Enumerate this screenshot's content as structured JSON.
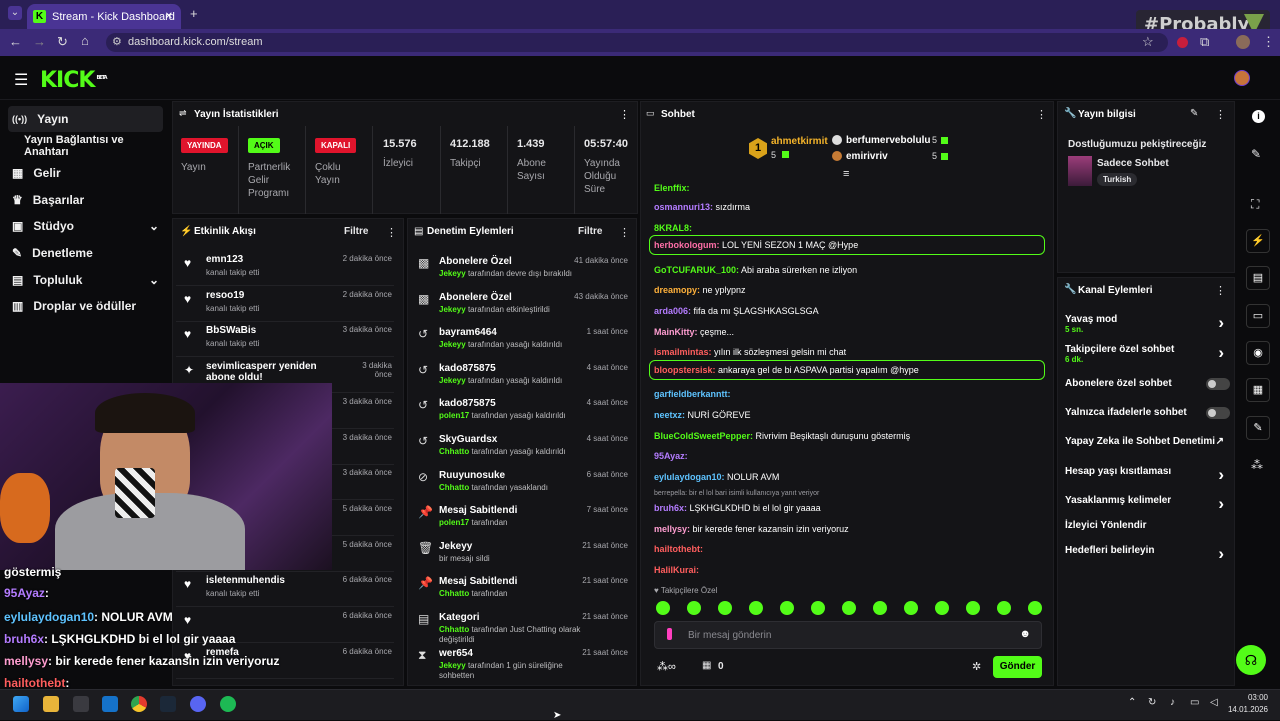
{
  "browser": {
    "tab_title": "Stream - Kick Dashboard",
    "url": "dashboard.kick.com/stream",
    "new_tab": "+",
    "close": "✕",
    "watermark": "#Probably"
  },
  "app": {
    "logo": "KICK",
    "logo_beta": "BETA"
  },
  "sidebar": {
    "items": [
      {
        "label": "Yayın",
        "icon": "((•))"
      },
      {
        "label": "Yayın Bağlantısı ve Anahtarı",
        "icon": ""
      },
      {
        "label": "Gelir",
        "icon": "▦"
      },
      {
        "label": "Başarılar",
        "icon": "🏆"
      },
      {
        "label": "Stüdyo",
        "icon": "▣"
      },
      {
        "label": "Denetleme",
        "icon": "🔧"
      },
      {
        "label": "Topluluk",
        "icon": "▤"
      },
      {
        "label": "Droplar ve ödüller",
        "icon": "▥"
      }
    ]
  },
  "stats": {
    "title": "Yayın İstatistikleri",
    "items": [
      {
        "badge": "YAYINDA",
        "label": "Yayın"
      },
      {
        "badge": "AÇIK",
        "label": "Partnerlik Gelir Programı"
      },
      {
        "badge": "KAPALI",
        "label": "Çoklu Yayın"
      },
      {
        "value": "15.576",
        "label": "İzleyici"
      },
      {
        "value": "412.188",
        "label": "Takipçi"
      },
      {
        "value": "1.439",
        "label": "Abone Sayısı"
      },
      {
        "value": "05:57:40",
        "label": "Yayında Olduğu Süre"
      }
    ]
  },
  "activity": {
    "title": "Etkinlik Akışı",
    "filter": "Filtre",
    "rows": [
      {
        "name": "emn123",
        "sub": "kanalı takip etti",
        "time": "2 dakika önce"
      },
      {
        "name": "resoo19",
        "sub": "kanalı takip etti",
        "time": "2 dakika önce"
      },
      {
        "name": "BbSWaBis",
        "sub": "kanalı takip etti",
        "time": "3 dakika önce"
      },
      {
        "name": "sevimlicasperr yeniden abone oldu!",
        "sub": "",
        "time": "3 dakika önce"
      },
      {
        "name": "",
        "sub": "",
        "time": "3 dakika önce"
      },
      {
        "name": "",
        "sub": "",
        "time": "3 dakika önce"
      },
      {
        "name": "",
        "sub": "",
        "time": "3 dakika önce"
      },
      {
        "name": "",
        "sub": "",
        "time": "5 dakika önce"
      },
      {
        "name": "",
        "sub": "kanalı takip etti",
        "time": "5 dakika önce"
      },
      {
        "name": "isletenmuhendis",
        "sub": "kanalı takip etti",
        "time": "6 dakika önce"
      },
      {
        "name": "",
        "sub": "",
        "time": "6 dakika önce"
      },
      {
        "name": "remefa",
        "sub": "",
        "time": "6 dakika önce"
      }
    ]
  },
  "moderation": {
    "title": "Denetim Eylemleri",
    "filter": "Filtre",
    "rows": [
      {
        "title": "Abonelere Özel",
        "actor": "Jekeyy",
        "rest": "tarafından devre dışı bırakıldı",
        "time": "41 dakika önce",
        "icon": "▩"
      },
      {
        "title": "Abonelere Özel",
        "actor": "Jekeyy",
        "rest": "tarafından etkinleştirildi",
        "time": "43 dakika önce",
        "icon": "▩"
      },
      {
        "title": "bayram6464",
        "actor": "Jekeyy",
        "rest": "tarafından yasağı kaldırıldı",
        "time": "1 saat önce",
        "icon": "↺"
      },
      {
        "title": "kado875875",
        "actor": "Jekeyy",
        "rest": "tarafından yasağı kaldırıldı",
        "time": "4 saat önce",
        "icon": "↺"
      },
      {
        "title": "kado875875",
        "actor": "polen17",
        "rest": "tarafından yasağı kaldırıldı",
        "time": "4 saat önce",
        "icon": "↺"
      },
      {
        "title": "SkyGuardsx",
        "actor": "Chhatto",
        "rest": "tarafından yasağı kaldırıldı",
        "time": "4 saat önce",
        "icon": "↺"
      },
      {
        "title": "Ruuyunosuke",
        "actor": "Chhatto",
        "rest": "tarafından yasaklandı",
        "time": "6 saat önce",
        "icon": "⊘"
      },
      {
        "title": "Mesaj Sabitlendi",
        "actor": "polen17",
        "rest": "tarafından",
        "time": "7 saat önce",
        "icon": "📌"
      },
      {
        "title": "Jekeyy",
        "actor": "",
        "rest": "bir mesajı sildi",
        "time": "21 saat önce",
        "icon": "🗑"
      },
      {
        "title": "Mesaj Sabitlendi",
        "actor": "Chhatto",
        "rest": "tarafından",
        "time": "21 saat önce",
        "icon": "📌"
      },
      {
        "title": "Kategori",
        "actor": "Chhatto",
        "rest": "tarafından Just Chatting olarak değiştirildi",
        "time": "21 saat önce",
        "icon": "▤"
      },
      {
        "title": "wer654",
        "actor": "Jekeyy",
        "rest": "tarafından 1 gün süreliğine sohbetten",
        "time": "21 saat önce",
        "icon": "⧗"
      }
    ]
  },
  "chat": {
    "title": "Sohbet",
    "top": [
      {
        "rank": "1",
        "name": "ahmetkirmit",
        "count": "5"
      },
      {
        "name": "berfumervebolulu",
        "count": "5"
      },
      {
        "name": "emirivriv",
        "count": "5"
      }
    ],
    "messages": [
      {
        "user": "Elenffix:",
        "text": "",
        "color": "#53fc18"
      },
      {
        "user": "osmannuri13:",
        "text": "sızdırma",
        "color": "#b47cff"
      },
      {
        "user": "8KRAL8:",
        "text": "",
        "color": "#53fc18"
      },
      {
        "user": "herbokologum:",
        "text": "LOL YENİ SEZON 1 MAÇ @Hype",
        "color": "#ff6fa8",
        "hl": true
      },
      {
        "user": "GoTCUFARUK_100:",
        "text": "Abi araba sürerken ne izliyon",
        "color": "#53fc18"
      },
      {
        "user": "dreamopy:",
        "text": "ne yplypnz",
        "color": "#ffb13b"
      },
      {
        "user": "arda006:",
        "text": "fifa da mı ŞLAGSHKASGLSGA",
        "color": "#b47cff"
      },
      {
        "user": "MainKitty:",
        "text": "çeşme...",
        "color": "#ff9ed1"
      },
      {
        "user": "ismailmintas:",
        "text": "yılın ilk sözleşmesi gelsin mi chat",
        "color": "#ff5e5e"
      },
      {
        "user": "bloopstersisk:",
        "text": "ankaraya gel de bi ASPAVA partisi yapalım @hype",
        "color": "#ff5e5e",
        "hl": true
      },
      {
        "user": "garfieldberkanntt:",
        "text": "",
        "color": "#5ec3ff"
      },
      {
        "user": "neetxz:",
        "text": "NURİ GÖREVE",
        "color": "#5ec3ff"
      },
      {
        "user": "BlueColdSweetPepper:",
        "text": "Rivrivim Beşiktaşlı duruşunu göstermiş",
        "color": "#53fc18"
      },
      {
        "user": "95Ayaz:",
        "text": "",
        "color": "#b47cff"
      },
      {
        "user": "eylulaydogan10:",
        "text": "NOLUR AVM",
        "color": "#5ec3ff"
      },
      {
        "user": "berrepella: bir el lol bari isimli kullanıcıya yanıt veriyor",
        "text": "",
        "color": "#9a9aa0",
        "reply": true
      },
      {
        "user": "bruh6x:",
        "text": "LŞKHGLKDHD bi el lol gir yaaaa",
        "color": "#b47cff"
      },
      {
        "user": "mellysy:",
        "text": "bir kerede fener kazansin izin veriyoruz",
        "color": "#ff9ed1"
      },
      {
        "user": "hailtothebt:",
        "text": "",
        "color": "#ff5e5e"
      },
      {
        "user": "HalilKurai:",
        "text": "",
        "color": "#ff5e5e"
      }
    ],
    "followers_only": "Takipçilere Özel",
    "input_placeholder": "Bir mesaj gönderin",
    "viewers_count": "0",
    "send": "Gönder"
  },
  "stream_info": {
    "title": "Yayın bilgisi",
    "stream_title": "Dostluğumuzu pekiştireceğiz",
    "category": "Sadece Sohbet",
    "language": "Turkish"
  },
  "channel_actions": {
    "title": "Kanal Eylemleri",
    "items": [
      {
        "label": "Yavaş mod",
        "sub": "5 sn.",
        "kind": "chevron"
      },
      {
        "label": "Takipçilere özel sohbet",
        "sub": "6 dk.",
        "kind": "chevron"
      },
      {
        "label": "Abonelere özel sohbet",
        "sub": "",
        "kind": "toggle"
      },
      {
        "label": "Yalnızca ifadelerle sohbet",
        "sub": "",
        "kind": "toggle"
      },
      {
        "label": "Yapay Zeka ile Sohbet Denetimi",
        "sub": "",
        "kind": "external"
      },
      {
        "label": "Hesap yaşı kısıtlaması",
        "sub": "",
        "kind": "chevron"
      },
      {
        "label": "Yasaklanmış kelimeler",
        "sub": "",
        "kind": "chevron"
      },
      {
        "label": "İzleyici Yönlendir",
        "sub": "",
        "kind": "none"
      },
      {
        "label": "Hedefleri belirleyin",
        "sub": "",
        "kind": "chevron"
      }
    ]
  },
  "overlay_chat": [
    {
      "user": "göstermiş",
      "text": "",
      "color": "#ffffff"
    },
    {
      "user": "95Ayaz",
      "text": ":",
      "color": "#b47cff"
    },
    {
      "user": "eylulaydogan10",
      "text": ": NOLUR AVM",
      "color": "#5ec3ff"
    },
    {
      "user": "bruh6x",
      "text": ": LŞKHGLKDHD bi el lol gir yaaaa",
      "color": "#b47cff"
    },
    {
      "user": "mellysy",
      "text": ": bir kerede fener kazansin izin veriyoruz",
      "color": "#ff9ed1"
    },
    {
      "user": "hailtothebt",
      "text": ":",
      "color": "#ff5e5e"
    }
  ],
  "taskbar": {
    "time": "03:00",
    "date": "14.01.2026"
  },
  "colors": {
    "accent": "#53fc18",
    "live": "#e0142c"
  }
}
